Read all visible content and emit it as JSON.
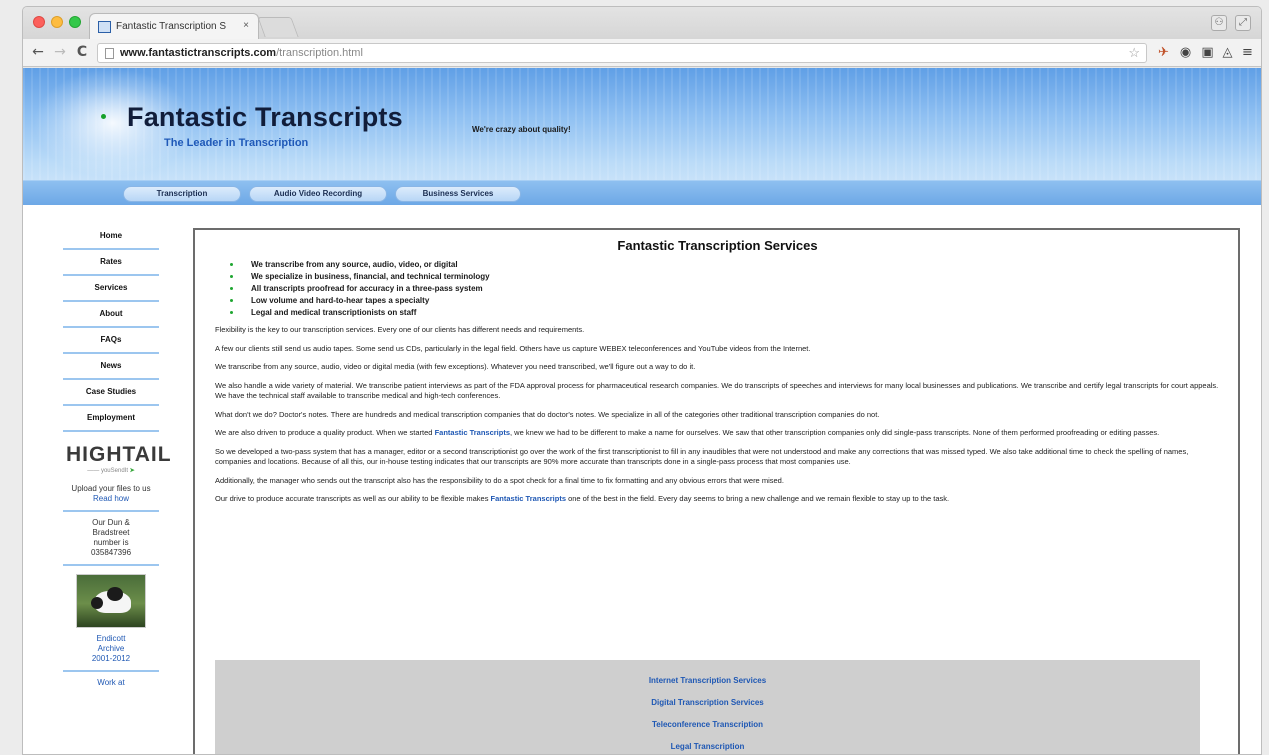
{
  "browser": {
    "tab_title": "Fantastic Transcription S",
    "tab_close": "×",
    "url_domain": "www.fantastictranscripts.com",
    "url_path": "/transcription.html",
    "nav": {
      "back": "←",
      "forward": "→",
      "reload": "C"
    }
  },
  "site": {
    "title": "Fantastic Transcripts",
    "subtitle": "The Leader in Transcription",
    "tagline": "We're crazy about quality!",
    "nav_tabs": [
      "Transcription",
      "Audio Video Recording",
      "Business Services"
    ]
  },
  "sidebar": {
    "links": [
      "Home",
      "Rates",
      "Services",
      "About",
      "FAQs",
      "News",
      "Case Studies",
      "Employment"
    ],
    "hightail_logo": "HIGHTAIL",
    "hightail_sub_prefix": "—— youSendIt",
    "hightail_sub_mark": "➤",
    "upload_text": "Upload your files to us",
    "read_how": "Read how",
    "dun_line1": "Our Dun &",
    "dun_line2": "Bradstreet",
    "dun_line3": "number is",
    "dun_line4": "035847396",
    "archive_line1": "Endicott",
    "archive_line2": "Archive",
    "archive_line3": "2001-2012",
    "work_at": "Work at"
  },
  "content": {
    "heading": "Fantastic Transcription Services",
    "bullets": [
      "We transcribe from any source, audio, video, or digital",
      "We specialize in business, financial, and technical terminology",
      "All transcripts proofread for accuracy in a three-pass system",
      "Low volume and hard-to-hear tapes a specialty",
      "Legal and medical transcriptionists on staff"
    ],
    "p1": "Flexibility is the key to our transcription services. Every one of our clients has different needs and requirements.",
    "p2": "A few our clients still send us audio tapes. Some send us CDs, particularly in the legal field. Others have us capture WEBEX teleconferences and YouTube videos from the Internet.",
    "p3": "We transcribe from any source, audio, video or digital media (with few exceptions). Whatever you need transcribed, we'll figure out a way to do it.",
    "p4": "We also handle a wide variety of material. We transcribe patient interviews as part of the FDA approval process for pharmaceutical research companies. We do transcripts of speeches and interviews for many local businesses and publications. We transcribe and certify legal transcripts for court appeals. We have the technical staff available to transcribe medical and high-tech conferences.",
    "p5": "What don't we do? Doctor's notes. There are hundreds and medical transcription companies that do doctor's notes. We specialize in all of the categories other traditional transcription companies do not.",
    "p6_a": "We are also driven to produce a quality product. When we started ",
    "p6_link": "Fantastic Transcripts",
    "p6_b": ", we knew we had to be different to make a name for ourselves. We saw that other transcription companies only did single-pass transcripts. None of them performed proofreading or editing passes.",
    "p7": "So we developed a two-pass system that has a manager, editor or a second transcriptionist go over the work of the first transcriptionist to fill in any inaudibles that were not understood and make any corrections that was missed typed. We also take additional time to check the spelling of names, companies and locations. Because of all this, our in-house testing indicates that our transcripts are 90% more accurate than transcripts done in a single-pass process that most companies use.",
    "p8": "Additionally, the manager who sends out the transcript also has the responsibility to do a spot check for a final time to fix formatting and any obvious errors that were mised.",
    "p9_a": "Our drive to produce accurate transcripts as well as our ability to be flexible makes ",
    "p9_link": "Fantastic Transcripts",
    "p9_b": " one of the best in the field. Every day seems to bring a new challenge and we remain flexible to stay up to the task.",
    "service_links": [
      "Internet Transcription Services",
      "Digital Transcription Services",
      "Teleconference Transcription",
      "Legal Transcription"
    ]
  },
  "colors": {
    "link": "#1f58b4",
    "bullet": "#20a632",
    "banner_top": "#5f9fe6",
    "banner_bottom": "#d8eafb"
  }
}
